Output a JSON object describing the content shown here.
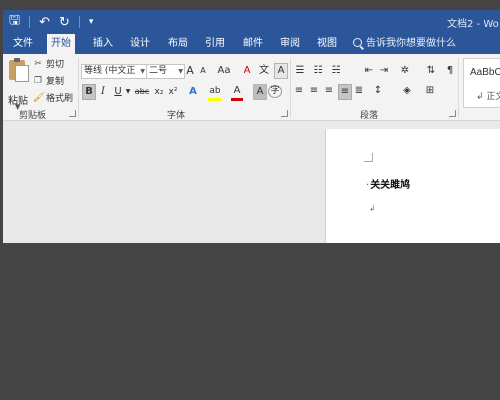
{
  "title_bar": {
    "window_title": "文档2 - Wo",
    "qat": {
      "save": "🖫",
      "undo": "↶",
      "redo": "↻",
      "more": "▾"
    }
  },
  "tabs": [
    {
      "label": "文件"
    },
    {
      "label": "开始"
    },
    {
      "label": "插入"
    },
    {
      "label": "设计"
    },
    {
      "label": "布局"
    },
    {
      "label": "引用"
    },
    {
      "label": "邮件"
    },
    {
      "label": "审阅"
    },
    {
      "label": "视图"
    }
  ],
  "tell_me": "告诉我你想要做什么",
  "clipboard": {
    "paste": "粘贴",
    "cut": "剪切",
    "copy": "复制",
    "format_painter": "格式刷",
    "group": "剪贴板"
  },
  "font": {
    "name": "等线 (中文正",
    "size": "二号",
    "grow": "A",
    "shrink": "A",
    "change_case": "Aa",
    "clear": "A",
    "wen": "文",
    "char_border": "A",
    "bold": "B",
    "italic": "I",
    "underline": "U",
    "strike": "abc",
    "sub": "x₂",
    "sup": "x²",
    "text_effects": "A",
    "highlight": "ab",
    "font_color": "A",
    "char_shading": "A",
    "enclose": "字",
    "group": "字体"
  },
  "paragraph": {
    "group": "段落"
  },
  "styles": {
    "preview": "AaBbCc",
    "name": "正文"
  },
  "document": {
    "line1": "关关雎鸠",
    "bullet": "·",
    "end_mark": "↲"
  },
  "colors": {
    "word_blue": "#2b579a",
    "highlight": "#ffff00",
    "font_red": "#d00000"
  }
}
